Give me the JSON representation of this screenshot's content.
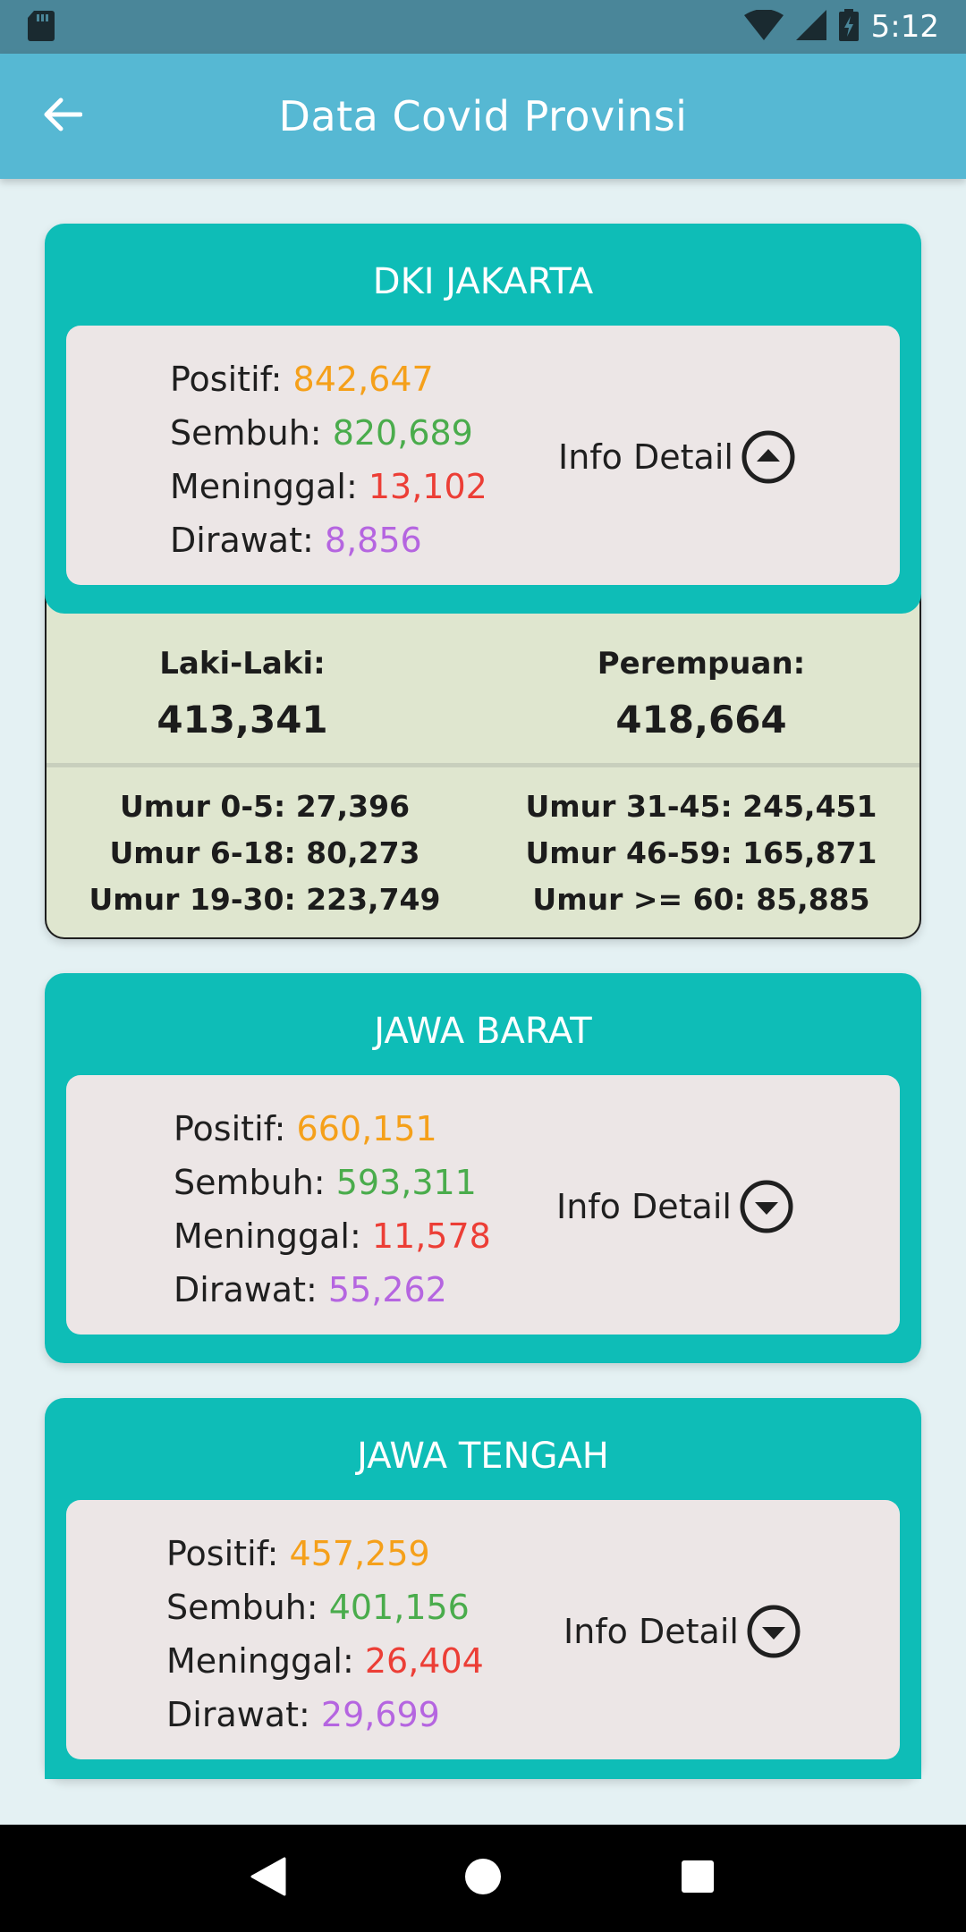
{
  "status_bar": {
    "time": "5:12",
    "icons": [
      "sd-card-icon",
      "wifi-icon",
      "cell-signal-icon",
      "battery-charging-icon"
    ]
  },
  "app_bar": {
    "title": "Data Covid Provinsi",
    "back_icon": "arrow-left-icon"
  },
  "colors": {
    "positif": "#f5a01a",
    "sembuh": "#4aac4c",
    "meninggal": "#ec3e36",
    "dirawat": "#b565e0",
    "card_header": "#0ebdb7",
    "app_bar": "#56b8d3"
  },
  "labels": {
    "positif": "Positif:",
    "sembuh": "Sembuh:",
    "meninggal": "Meninggal:",
    "dirawat": "Dirawat:",
    "info_detail": "Info Detail",
    "laki_laki": "Laki-Laki:",
    "perempuan": "Perempuan:"
  },
  "provinces": [
    {
      "name": "DKI JAKARTA",
      "positif": "842,647",
      "sembuh": "820,689",
      "meninggal": "13,102",
      "dirawat": "8,856",
      "expanded": true,
      "detail": {
        "laki_laki": "413,341",
        "perempuan": "418,664",
        "ages": [
          "Umur 0-5: 27,396",
          "Umur 6-18: 80,273",
          "Umur 19-30: 223,749",
          "Umur 31-45: 245,451",
          "Umur 46-59: 165,871",
          "Umur >= 60: 85,885"
        ]
      }
    },
    {
      "name": "JAWA BARAT",
      "positif": "660,151",
      "sembuh": "593,311",
      "meninggal": "11,578",
      "dirawat": "55,262",
      "expanded": false
    },
    {
      "name": "JAWA TENGAH",
      "positif": "457,259",
      "sembuh": "401,156",
      "meninggal": "26,404",
      "dirawat": "29,699",
      "expanded": false
    }
  ],
  "nav_bar": {
    "icons": [
      "back-triangle-icon",
      "home-circle-icon",
      "recents-square-icon"
    ]
  }
}
